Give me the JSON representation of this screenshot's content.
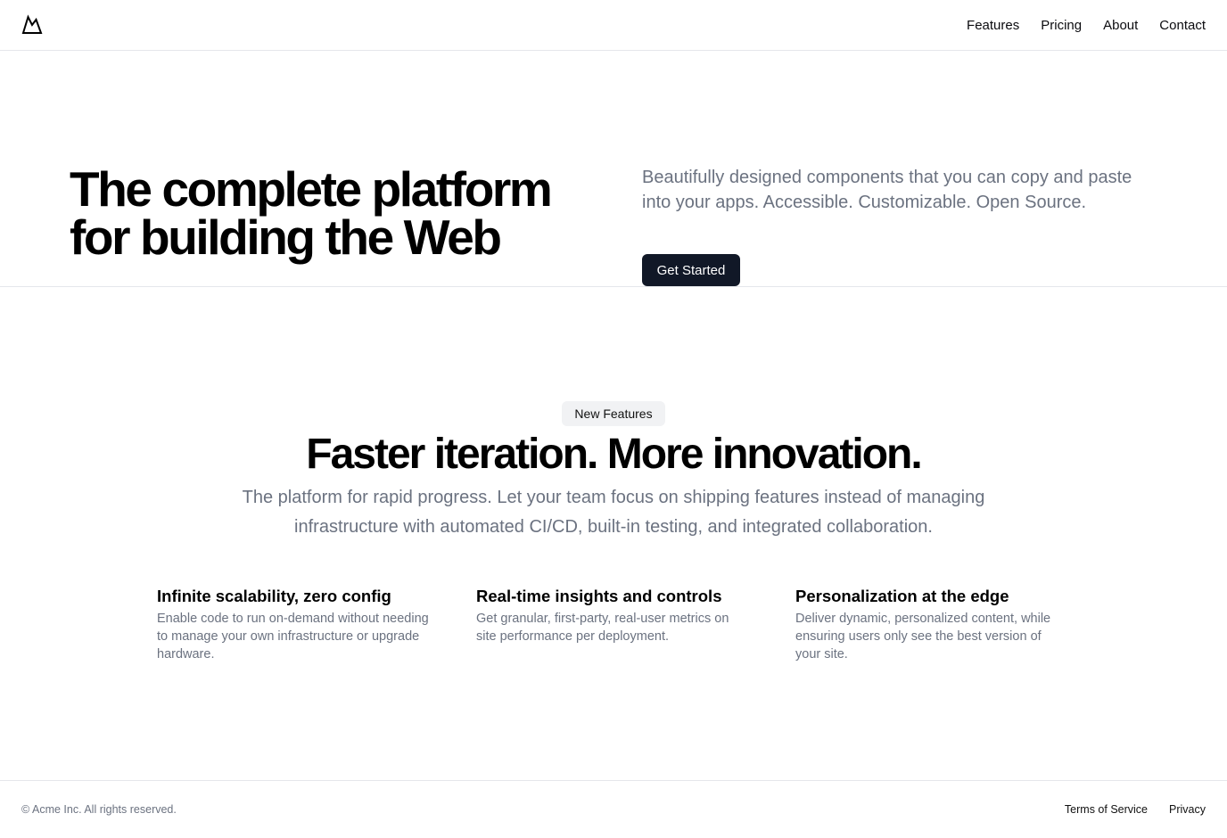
{
  "header": {
    "logo_icon": "mountain-icon",
    "nav": [
      {
        "label": "Features"
      },
      {
        "label": "Pricing"
      },
      {
        "label": "About"
      },
      {
        "label": "Contact"
      }
    ]
  },
  "hero": {
    "title_line1": "The complete platform",
    "title_line2": "for building the Web",
    "description": "Beautifully designed components that you can copy and paste into your apps. Accessible. Customizable. Open Source.",
    "cta_label": "Get Started",
    "cta_color": "#111827"
  },
  "features": {
    "badge": "New Features",
    "title": "Faster iteration. More innovation.",
    "description": "The platform for rapid progress. Let your team focus on shipping features instead of managing infrastructure with automated CI/CD, built-in testing, and integrated collaboration.",
    "items": [
      {
        "title": "Infinite scalability, zero config",
        "description": "Enable code to run on-demand without needing to manage your own infrastructure or upgrade hardware."
      },
      {
        "title": "Real-time insights and controls",
        "description": "Get granular, first-party, real-user metrics on site performance per deployment."
      },
      {
        "title": "Personalization at the edge",
        "description": "Deliver dynamic, personalized content, while ensuring users only see the best version of your site."
      }
    ]
  },
  "footer": {
    "copyright": "© Acme Inc. All rights reserved.",
    "links": [
      {
        "label": "Terms of Service"
      },
      {
        "label": "Privacy"
      }
    ]
  }
}
